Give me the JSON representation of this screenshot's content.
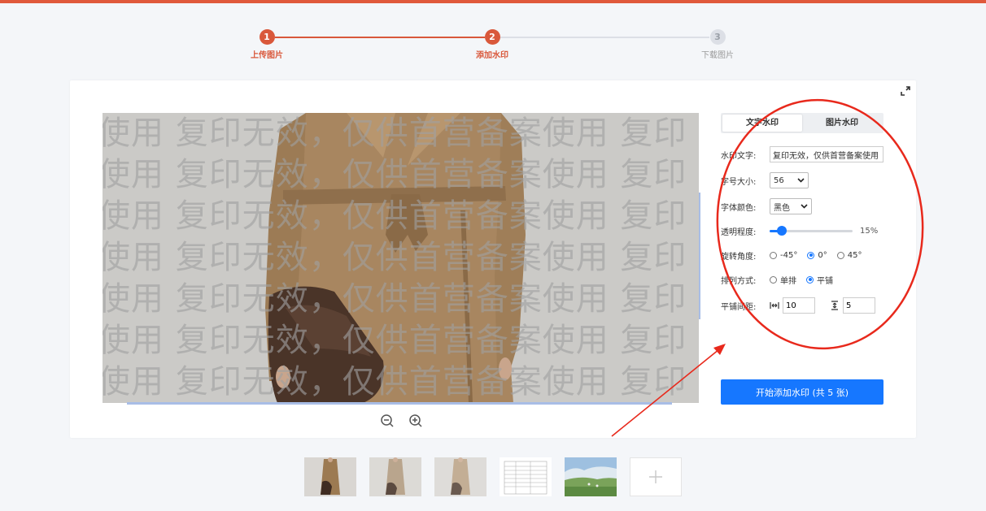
{
  "steps": [
    {
      "num": "1",
      "label": "上传图片"
    },
    {
      "num": "2",
      "label": "添加水印"
    },
    {
      "num": "3",
      "label": "下载图片"
    }
  ],
  "preview": {
    "watermark_rows": [
      "使用 复印无效，仅供首营备案使用 复印",
      "使用 复印无效，仅供首营备案使用 复印",
      "使用 复印无效，仅供首营备案使用 复印",
      "使用 复印无效，仅供首营备案使用 复印",
      "使用 复印无效，仅供首营备案使用 复印",
      "使用 复印无效，仅供首营备案使用 复印",
      "使用 复印无效，仅供首营备案使用 复印"
    ]
  },
  "tabs": [
    "文字水印",
    "图片水印"
  ],
  "form": {
    "text_label": "水印文字:",
    "text_value": "复印无效，仅供首营备案使用",
    "size_label": "字号大小:",
    "size_value": "56",
    "color_label": "字体颜色:",
    "color_value": "黑色",
    "opacity_label": "透明程度:",
    "opacity_value": 15,
    "opacity_text": "15%",
    "rotate_label": "旋转角度:",
    "rotate_options": [
      "-45°",
      "0°",
      "45°"
    ],
    "rotate_selected": "0°",
    "layout_label": "排列方式:",
    "layout_options": [
      "单排",
      "平铺"
    ],
    "layout_selected": "平铺",
    "spacing_label": "平铺间距:",
    "spacing_h": "10",
    "spacing_v": "5"
  },
  "start_button": "开始添加水印 (共 5 张)",
  "thumbnails": [
    "coat-photo-1",
    "coat-photo-2",
    "coat-photo-3",
    "document-scan",
    "landscape-photo"
  ],
  "colors": {
    "accent": "#d9583b",
    "primary": "#1677ff",
    "annotation": "#e8291c"
  }
}
